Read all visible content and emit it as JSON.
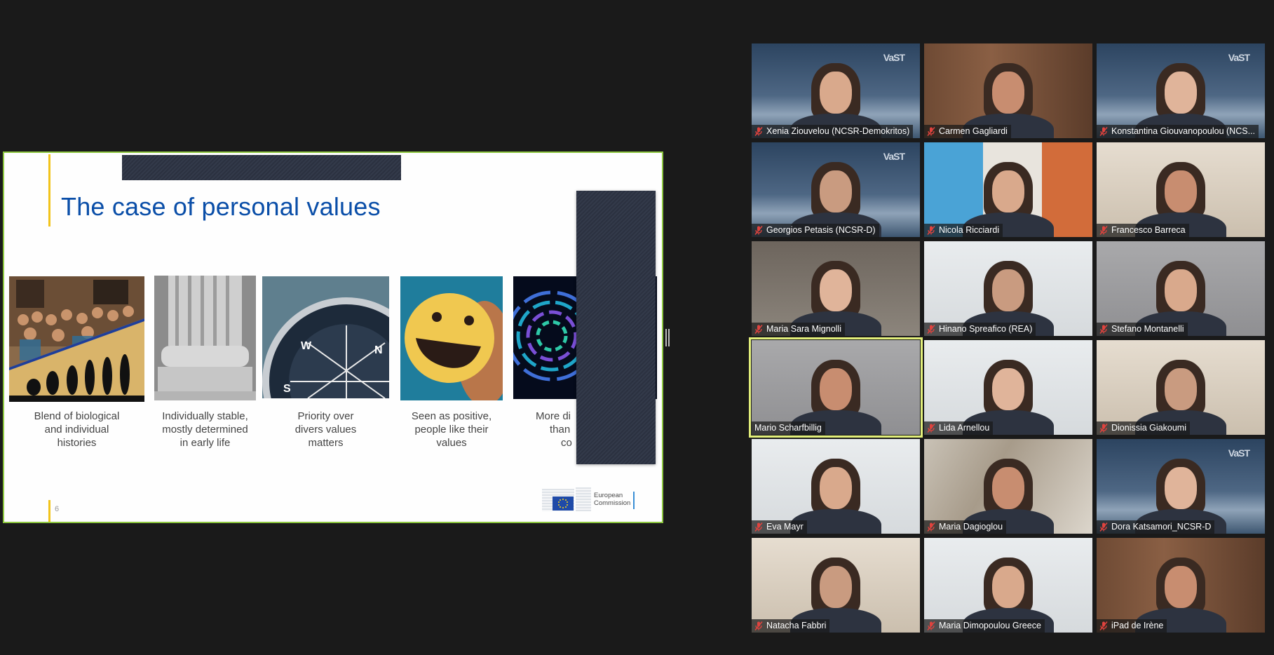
{
  "slide": {
    "title": "The case of personal values",
    "page_number": "6",
    "logo_text_line1": "European",
    "logo_text_line2": "Commission",
    "items": [
      {
        "image": "evolution-children-photo",
        "caption_lines": [
          "Blend of biological",
          "and individual",
          "histories"
        ]
      },
      {
        "image": "stone-column-photo",
        "caption_lines": [
          "Individually stable,",
          "mostly determined",
          "in early life"
        ]
      },
      {
        "image": "compass-photo",
        "caption_lines": [
          "Priority over",
          "divers values",
          "matters"
        ]
      },
      {
        "image": "smiley-face-photo",
        "caption_lines": [
          "Seen as positive,",
          "people like their",
          "values"
        ]
      },
      {
        "image": "abstract-circles-photo",
        "caption_lines": [
          "More di",
          "than",
          "co"
        ]
      }
    ]
  },
  "participants": [
    {
      "name": "Xenia Ziouvelou (NCSR-Demokritos)",
      "muted": true,
      "background": "vast"
    },
    {
      "name": "Carmen Gagliardi",
      "muted": true,
      "background": "bookshelf"
    },
    {
      "name": "Konstantina Giouvanopoulou (NCS...",
      "muted": true,
      "background": "vast"
    },
    {
      "name": "Georgios Petasis (NCSR-D)",
      "muted": true,
      "background": "vast"
    },
    {
      "name": "Nicola Ricciardi",
      "muted": true,
      "background": "poster"
    },
    {
      "name": "Francesco Barreca",
      "muted": true,
      "background": "room"
    },
    {
      "name": "Maria Sara Mignolli",
      "muted": true,
      "background": "dark-room"
    },
    {
      "name": "Hinano Spreafico (REA)",
      "muted": true,
      "background": "white-wall"
    },
    {
      "name": "Stefano Montanelli",
      "muted": true,
      "background": "grey-wall"
    },
    {
      "name": "Mario Scharfbillig",
      "muted": false,
      "active_speaker": true,
      "background": "grey-wall"
    },
    {
      "name": "Lida Arnellou",
      "muted": true,
      "background": "white-wall"
    },
    {
      "name": "Dionissia Giakoumi",
      "muted": true,
      "background": "room"
    },
    {
      "name": "Eva Mayr",
      "muted": true,
      "background": "white-wall"
    },
    {
      "name": "Maria Dagioglou",
      "muted": true,
      "background": "blurred"
    },
    {
      "name": "Dora Katsamori_NCSR-D",
      "muted": true,
      "background": "vast"
    },
    {
      "name": "Natacha Fabbri",
      "muted": true,
      "background": "room"
    },
    {
      "name": "Maria Dimopoulou Greece",
      "muted": true,
      "background": "white-wall"
    },
    {
      "name": "iPad de Irène",
      "muted": true,
      "background": "bookshelf"
    }
  ],
  "vast_logo_text": "VaST",
  "colors": {
    "slide_border": "#8cc63f",
    "active_speaker_border": "#e2ef7a",
    "title_blue": "#0a4ea8",
    "accent_yellow": "#f2c41c",
    "mute_red": "#e0433e"
  }
}
